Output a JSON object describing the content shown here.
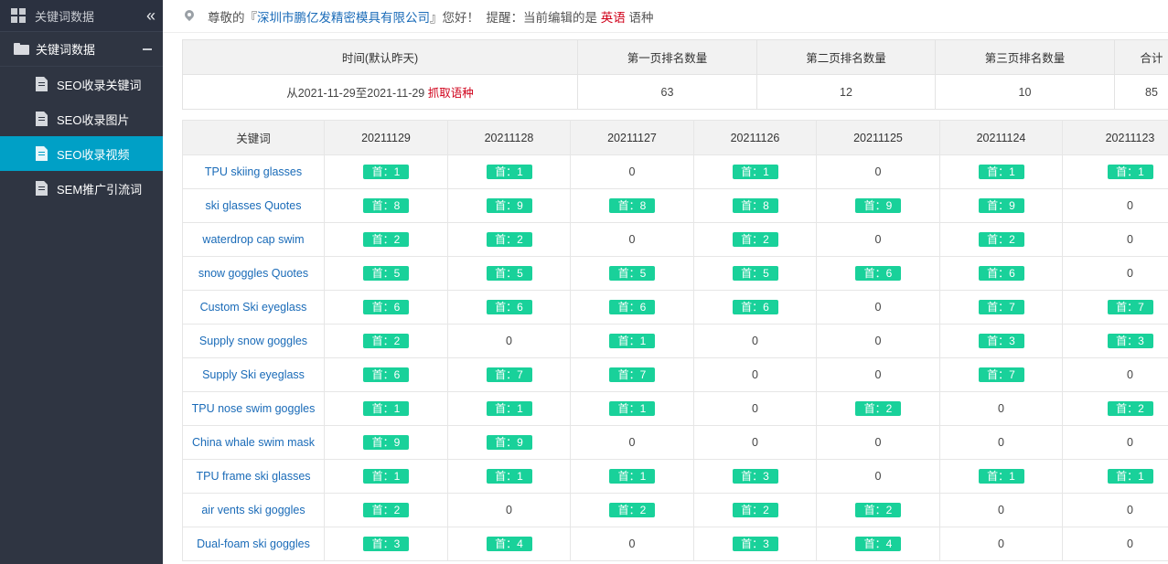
{
  "sidebar": {
    "header_title": "关键词数据",
    "collapse_glyph": "«",
    "group_label": "关键词数据",
    "items": [
      {
        "label": "SEO收录关键词",
        "active": false
      },
      {
        "label": "SEO收录图片",
        "active": false
      },
      {
        "label": "SEO收录视频",
        "active": true
      },
      {
        "label": "SEM推广引流词",
        "active": false
      }
    ]
  },
  "topbar": {
    "greeting_prefix": "尊敬的『",
    "company": "深圳市鹏亿发精密模具有限公司",
    "greeting_suffix": "』您好！  提醒：当前编辑的是 ",
    "language": "英语",
    "language_suffix": " 语种"
  },
  "summary": {
    "headers": [
      "时间(默认昨天)",
      "第一页排名数量",
      "第二页排名数量",
      "第三页排名数量",
      "合计"
    ],
    "range_text": "从2021-11-29至2021-11-29",
    "fetch_link": "抓取语种",
    "page1": "63",
    "page2": "12",
    "page3": "10",
    "total": "85"
  },
  "table": {
    "headers": [
      "关键词",
      "20211129",
      "20211128",
      "20211127",
      "20211126",
      "20211125",
      "20211124",
      "20211123"
    ],
    "badge_prefix": "首：",
    "rows": [
      {
        "keyword": "TPU skiing glasses",
        "ranks": [
          1,
          1,
          0,
          1,
          0,
          1,
          1
        ]
      },
      {
        "keyword": "ski glasses Quotes",
        "ranks": [
          8,
          9,
          8,
          8,
          9,
          9,
          0
        ]
      },
      {
        "keyword": "waterdrop cap swim",
        "ranks": [
          2,
          2,
          0,
          2,
          0,
          2,
          0
        ]
      },
      {
        "keyword": "snow goggles Quotes",
        "ranks": [
          5,
          5,
          5,
          5,
          6,
          6,
          0
        ]
      },
      {
        "keyword": "Custom Ski eyeglass",
        "ranks": [
          6,
          6,
          6,
          6,
          0,
          7,
          7
        ]
      },
      {
        "keyword": "Supply snow goggles",
        "ranks": [
          2,
          0,
          1,
          0,
          0,
          3,
          3
        ]
      },
      {
        "keyword": "Supply Ski eyeglass",
        "ranks": [
          6,
          7,
          7,
          0,
          0,
          7,
          0
        ]
      },
      {
        "keyword": "TPU nose swim goggles",
        "ranks": [
          1,
          1,
          1,
          0,
          2,
          0,
          2
        ]
      },
      {
        "keyword": "China whale swim mask",
        "ranks": [
          9,
          9,
          0,
          0,
          0,
          0,
          0
        ]
      },
      {
        "keyword": "TPU frame ski glasses",
        "ranks": [
          1,
          1,
          1,
          3,
          0,
          1,
          1
        ]
      },
      {
        "keyword": "air vents ski goggles",
        "ranks": [
          2,
          0,
          2,
          2,
          2,
          0,
          0
        ]
      },
      {
        "keyword": "Dual-foam ski goggles",
        "ranks": [
          3,
          4,
          0,
          3,
          4,
          0,
          0
        ]
      }
    ]
  },
  "colors": {
    "sidebar_bg": "#2f3542",
    "active_bg": "#00a0c6",
    "badge_bg": "#19d19a",
    "link": "#1a6bb8",
    "alert_red": "#d0021b"
  },
  "icons": [
    "grid-icon",
    "collapse-icon",
    "folder-icon",
    "minus-icon",
    "document-icon",
    "location-pin-icon"
  ]
}
